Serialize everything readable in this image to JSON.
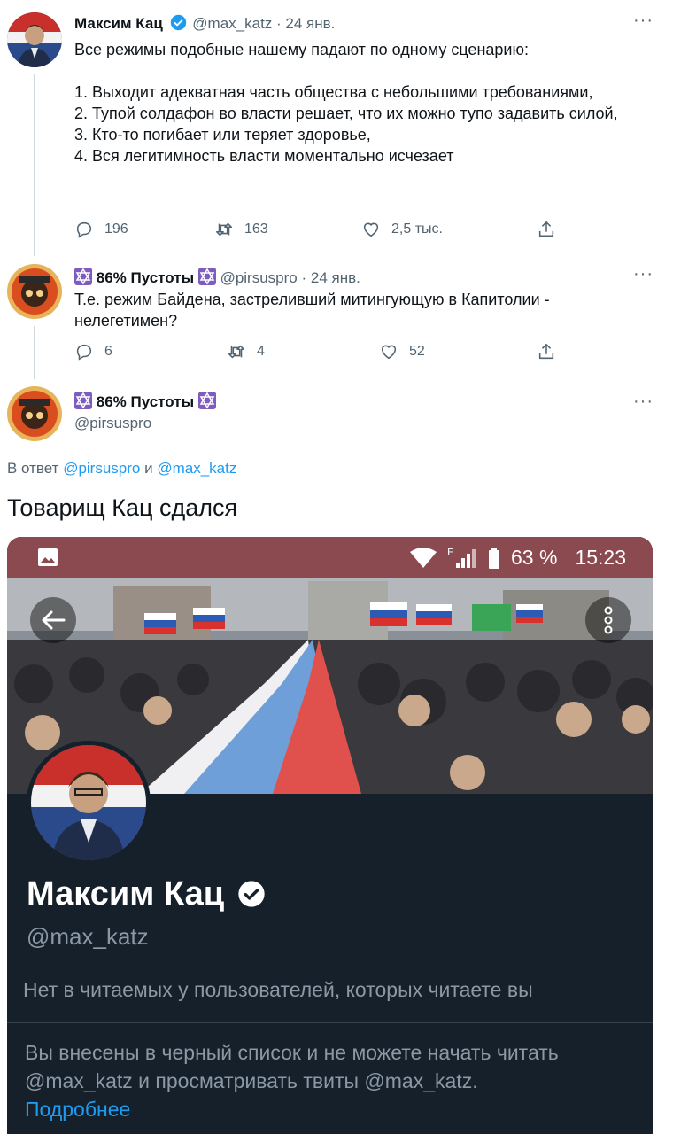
{
  "tweet1": {
    "name": "Максим Кац",
    "handle": "@max_katz",
    "date": "· 24 янв.",
    "text": "Все режимы подобные нашему падают по одному сценарию:\n\n1. Выходит адекватная часть общества с небольшими требованиями,\n2. Тупой солдафон во власти решает, что их можно тупо задавить силой,\n3. Кто-то погибает или теряет здоровье,\n4. Вся легитимность власти моментально исчезает",
    "replies": "196",
    "retweets": "163",
    "likes": "2,5 тыс."
  },
  "tweet2": {
    "name": "86% Пустоты",
    "handle": "@pirsuspro",
    "date": "· 24 янв.",
    "text": "Т.е. режим Байдена, застреливший митингующую в Капитолии - нелегетимен?",
    "replies": "6",
    "retweets": "4",
    "likes": "52"
  },
  "tweet3": {
    "name": "86% Пустоты",
    "handle": "@pirsuspro",
    "reply_prefix": "В ответ",
    "reply_user1": "@pirsuspro",
    "reply_and": "и",
    "reply_user2": "@max_katz",
    "text": "Товарищ Кац сдался"
  },
  "embedded": {
    "battery": "63 %",
    "time": "15:23",
    "profile_name": "Максим Кац",
    "profile_handle": "@max_katz",
    "follow_note": "Нет в читаемых у пользователей, которых читаете вы",
    "blocked_text": "Вы внесены в черный список и не можете начать читать @max_katz и просматривать твиты @max_katz.",
    "more_link": "Подробнее"
  },
  "colors": {
    "accent": "#1d9bf0",
    "muted": "#536471",
    "dark_bg": "#15202b",
    "status_bar": "#8a4a4f"
  },
  "icons": [
    "more-icon",
    "verified-icon",
    "reply-icon",
    "retweet-icon",
    "like-icon",
    "share-icon",
    "star-of-david-icon",
    "back-arrow-icon",
    "kebab-icon",
    "wifi-icon",
    "signal-icon",
    "battery-icon",
    "image-icon"
  ]
}
